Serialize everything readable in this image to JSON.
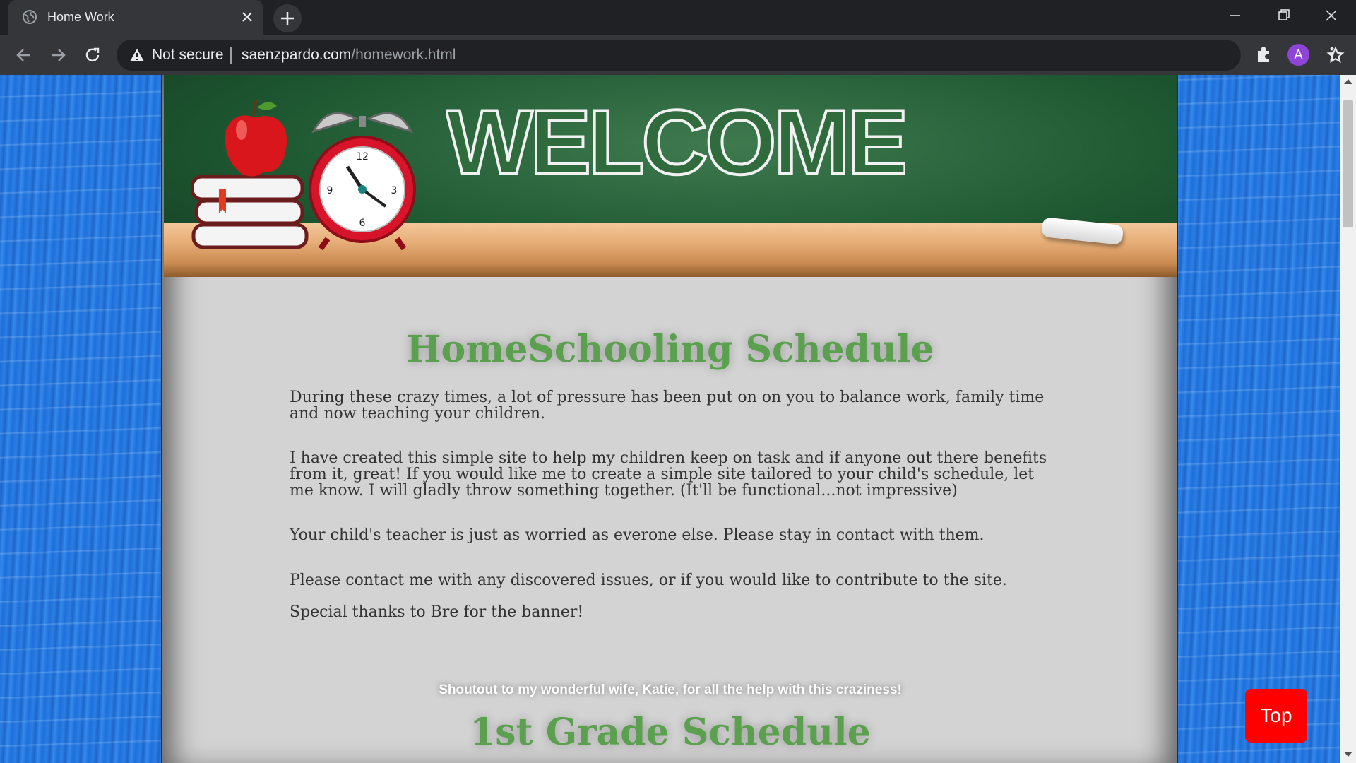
{
  "browser": {
    "tab_title": "Home Work",
    "security_label": "Not secure",
    "url_host": "saenzpardo.com",
    "url_path": "/homework.html",
    "profile_initial": "A"
  },
  "banner": {
    "headline": "WELCOME"
  },
  "page": {
    "title": "HomeSchooling Schedule",
    "paragraphs": [
      "During these crazy times, a lot of pressure has been put on on you to balance work, family time and now teaching your children.",
      "I have created this simple site to help my children keep on task and if anyone out there benefits from it, great! If you would like me to create a simple site tailored to your child's schedule, let me know. I will gladly throw something together. (It'll be functional...not impressive)",
      "Your child's teacher is just as worried as everone else. Please stay in contact with them.",
      "Please contact me with any discovered issues, or if you would like to contribute to the site.",
      "Special thanks to Bre for the banner!"
    ],
    "shoutout": "Shoutout to my wonderful wife, Katie, for all the help with this craziness!",
    "section_title": "1st Grade Schedule",
    "top_button": "Top"
  },
  "colors": {
    "heading_green": "#5aa04e",
    "top_button_red": "#ff0000",
    "background_blue": "#1f6fd6",
    "avatar_purple": "#8e44d6"
  },
  "icons": [
    "globe-icon",
    "close-icon",
    "plus-icon",
    "minimize-icon",
    "maximize-icon",
    "window-close-icon",
    "back-arrow-icon",
    "forward-arrow-icon",
    "reload-icon",
    "warning-icon",
    "star-icon",
    "puzzle-icon",
    "menu-dots-icon"
  ]
}
